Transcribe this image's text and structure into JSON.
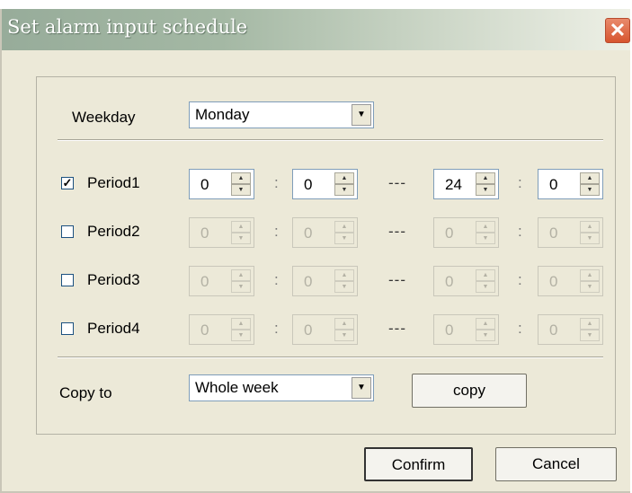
{
  "window": {
    "title": "Set alarm input schedule",
    "close_label": "✕"
  },
  "weekday": {
    "label": "Weekday",
    "value": "Monday"
  },
  "periods": [
    {
      "label": "Period1",
      "checked": true,
      "start_h": "0",
      "start_m": "0",
      "end_h": "24",
      "end_m": "0"
    },
    {
      "label": "Period2",
      "checked": false,
      "start_h": "0",
      "start_m": "0",
      "end_h": "0",
      "end_m": "0"
    },
    {
      "label": "Period3",
      "checked": false,
      "start_h": "0",
      "start_m": "0",
      "end_h": "0",
      "end_m": "0"
    },
    {
      "label": "Period4",
      "checked": false,
      "start_h": "0",
      "start_m": "0",
      "end_h": "0",
      "end_m": "0"
    }
  ],
  "separator_colon": ":",
  "separator_dash": "---",
  "copy_to": {
    "label": "Copy to",
    "value": "Whole week",
    "button": "copy"
  },
  "buttons": {
    "confirm": "Confirm",
    "cancel": "Cancel"
  }
}
